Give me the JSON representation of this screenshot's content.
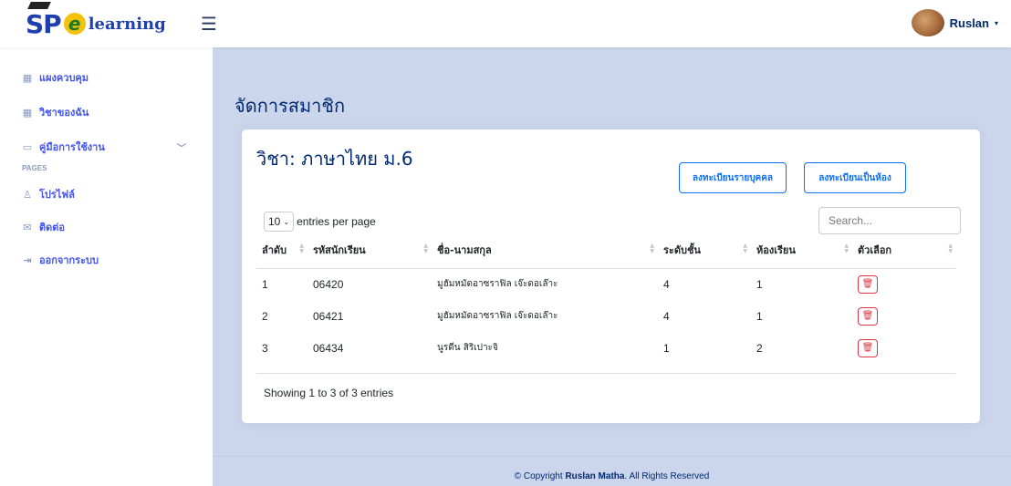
{
  "header": {
    "logo_sp": "SP",
    "logo_e": "e",
    "logo_text": "learning",
    "menu_icon": "hamburger-icon",
    "user_name": "Ruslan",
    "user_caret": "▾"
  },
  "sidebar": {
    "items": [
      {
        "label": "แผงควบคุม",
        "icon": "grid-icon"
      },
      {
        "label": "วิชาของฉัน",
        "icon": "grid-icon"
      },
      {
        "label": "คู่มือการใช้งาน",
        "icon": "book-icon"
      },
      {
        "label": "โปรไฟล์",
        "icon": "person-icon"
      },
      {
        "label": "ติดต่อ",
        "icon": "envelope-icon"
      },
      {
        "label": "ออกจากระบบ",
        "icon": "logout-icon"
      }
    ],
    "heading_pages": "PAGES"
  },
  "main": {
    "page_title": "จัดการสมาชิก",
    "card_title": "วิชา: ภาษาไทย ม.6",
    "btn_individual": "ลงทะเบียนรายบุคคล",
    "btn_classroom": "ลงทะเบียนเป็นห้อง",
    "per_page_value": "10",
    "per_page_label": "entries per page",
    "search_placeholder": "Search...",
    "columns": [
      "ลำดับ",
      "รหัสนักเรียน",
      "ชื่อ-นามสกุล",
      "ระดับชั้น",
      "ห้องเรียน",
      "ตัวเลือก"
    ],
    "rows": [
      {
        "no": "1",
        "id": "06420",
        "name": "มูฮัมหมัดอาซราฟิล เจ๊ะดอเล๊าะ",
        "level": "4",
        "room": "1"
      },
      {
        "no": "2",
        "id": "06421",
        "name": "มูฮัมหมัดอาซราฟิล เจ๊ะดอเล๊าะ",
        "level": "4",
        "room": "1"
      },
      {
        "no": "3",
        "id": "06434",
        "name": "นูรดีน สิริเปาะจิ",
        "level": "1",
        "room": "2"
      }
    ],
    "showing": "Showing 1 to 3 of 3 entries"
  },
  "footer": {
    "prefix": "© Copyright ",
    "name": "Ruslan Matha",
    "suffix": ". All Rights Reserved"
  }
}
